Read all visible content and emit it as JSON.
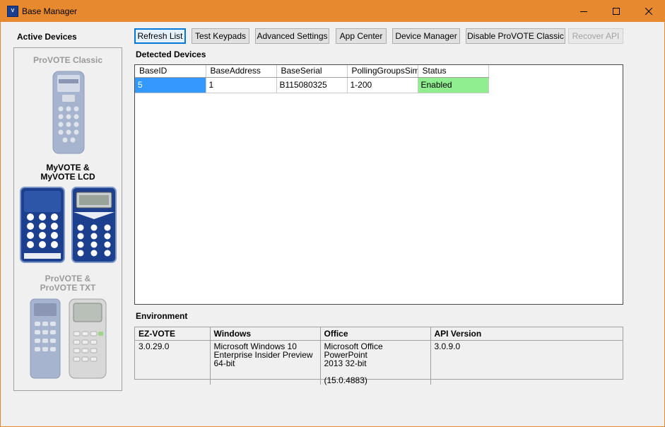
{
  "window": {
    "title": "Base Manager",
    "app_icon_text": "V",
    "accent": "#e6892f"
  },
  "left_panel": {
    "heading": "Active Devices",
    "devices": [
      {
        "title_line1": "ProVOTE Classic",
        "title_line2": "",
        "active": false
      },
      {
        "title_line1": "MyVOTE &",
        "title_line2": "MyVOTE LCD",
        "active": true
      },
      {
        "title_line1": "ProVOTE &",
        "title_line2": "ProVOTE TXT",
        "active": false
      }
    ]
  },
  "toolbar": {
    "refresh": "Refresh List",
    "test_keypads": "Test Keypads",
    "advanced_settings": "Advanced Settings",
    "app_center": "App Center",
    "device_manager": "Device Manager",
    "disable_provote": "Disable ProVOTE Classic",
    "recover_api": "Recover API"
  },
  "detected_devices": {
    "label": "Detected Devices",
    "columns": [
      "BaseID",
      "BaseAddress",
      "BaseSerial",
      "PollingGroupsSimple",
      "Status"
    ],
    "rows": [
      {
        "BaseID": "5",
        "BaseAddress": "1",
        "BaseSerial": "B115080325",
        "PollingGroupsSimple": "1-200",
        "Status": "Enabled"
      }
    ],
    "status_color": "#90ee90",
    "selected_color": "#3399ff"
  },
  "environment": {
    "label": "Environment",
    "headers": [
      "EZ-VOTE",
      "Windows",
      "Office",
      "API Version"
    ],
    "ezvote": "3.0.29.0",
    "windows_line1": "Microsoft Windows 10",
    "windows_line2": "Enterprise Insider Preview",
    "windows_line3": "64-bit",
    "office_line1": "Microsoft Office PowerPoint",
    "office_line2": "2013 32-bit",
    "office_line3": "(15.0.4883)",
    "api_version": "3.0.9.0"
  }
}
